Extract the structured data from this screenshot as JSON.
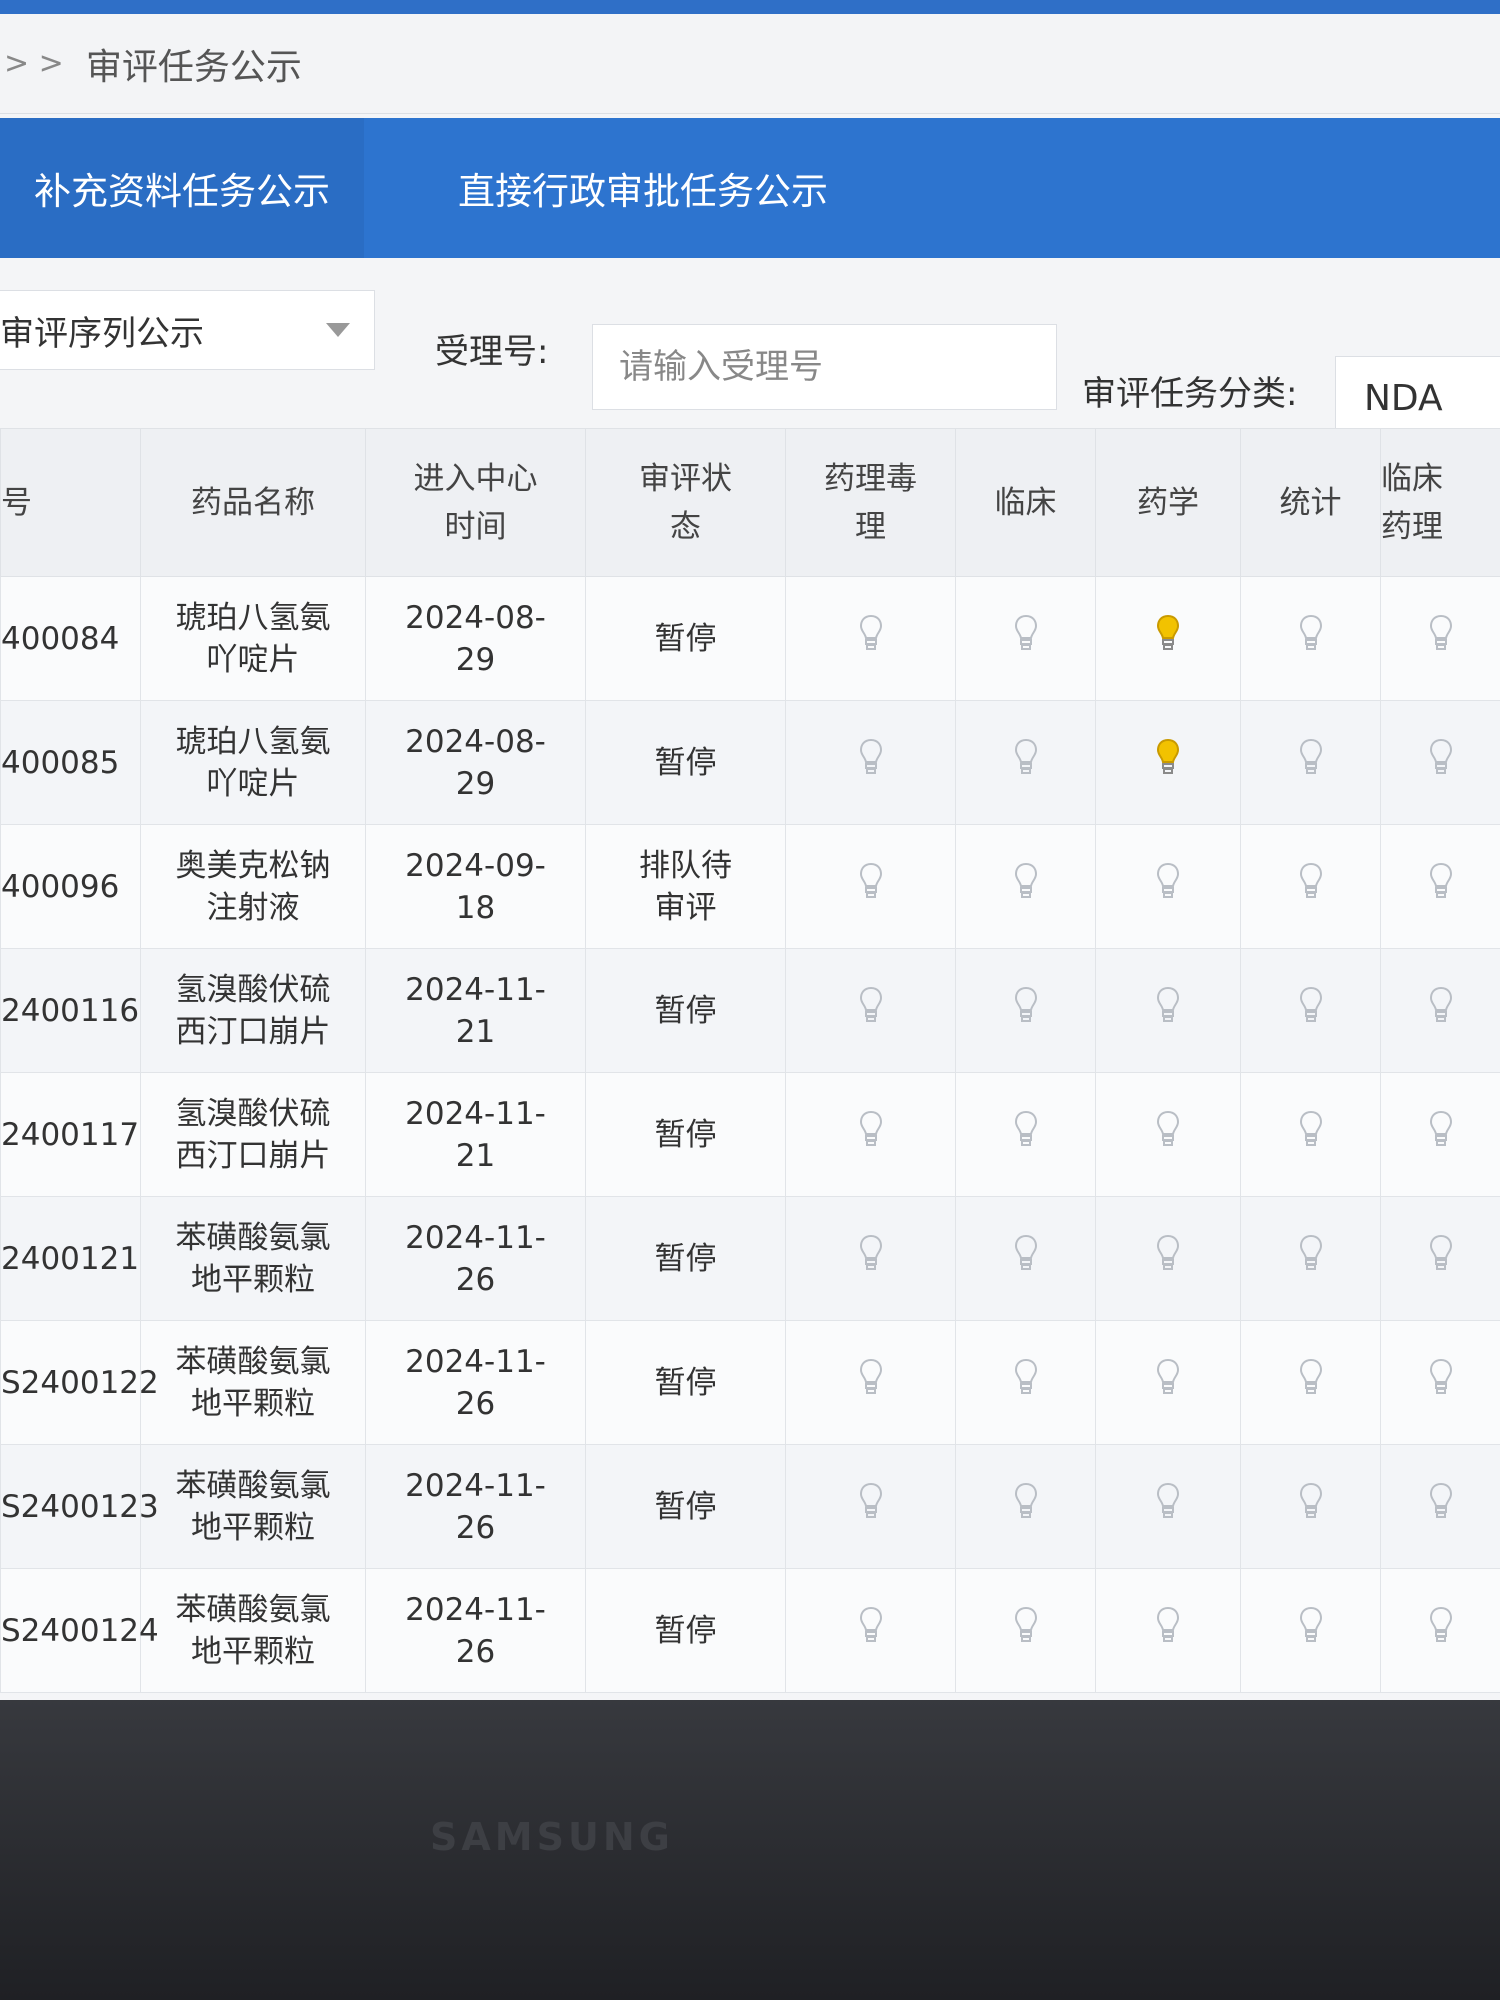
{
  "breadcrumb": {
    "separator": "> >",
    "current": "审评任务公示"
  },
  "tabs": [
    {
      "label": "补充资料任务公示"
    },
    {
      "label": "直接行政审批任务公示"
    }
  ],
  "filters": {
    "sequence_select": "审评序列公示",
    "accept_no_label": "受理号:",
    "accept_no_placeholder": "请输入受理号",
    "category_label": "审评任务分类:",
    "category_value": "NDA"
  },
  "table": {
    "headers": {
      "no": "号",
      "drug": "药品名称",
      "time_l1": "进入中心",
      "time_l2": "时间",
      "status_l1": "审评状",
      "status_l2": "态",
      "pharm_l1": "药理毒",
      "pharm_l2": "理",
      "clinical": "临床",
      "pharmacy": "药学",
      "stats": "统计",
      "cp_l1": "临床",
      "cp_l2": "药理"
    },
    "rows": [
      {
        "no": "400084",
        "drug1": "琥珀八氢氨",
        "drug2": "吖啶片",
        "time1": "2024-08-",
        "time2": "29",
        "status1": "暂停",
        "status2": "",
        "active_col": 2
      },
      {
        "no": "400085",
        "drug1": "琥珀八氢氨",
        "drug2": "吖啶片",
        "time1": "2024-08-",
        "time2": "29",
        "status1": "暂停",
        "status2": "",
        "active_col": 2
      },
      {
        "no": "400096",
        "drug1": "奥美克松钠",
        "drug2": "注射液",
        "time1": "2024-09-",
        "time2": "18",
        "status1": "排队待",
        "status2": "审评",
        "active_col": -1
      },
      {
        "no": "2400116",
        "drug1": "氢溴酸伏硫",
        "drug2": "西汀口崩片",
        "time1": "2024-11-",
        "time2": "21",
        "status1": "暂停",
        "status2": "",
        "active_col": -1
      },
      {
        "no": "2400117",
        "drug1": "氢溴酸伏硫",
        "drug2": "西汀口崩片",
        "time1": "2024-11-",
        "time2": "21",
        "status1": "暂停",
        "status2": "",
        "active_col": -1
      },
      {
        "no": "2400121",
        "drug1": "苯磺酸氨氯",
        "drug2": "地平颗粒",
        "time1": "2024-11-",
        "time2": "26",
        "status1": "暂停",
        "status2": "",
        "active_col": -1
      },
      {
        "no": "S2400122",
        "drug1": "苯磺酸氨氯",
        "drug2": "地平颗粒",
        "time1": "2024-11-",
        "time2": "26",
        "status1": "暂停",
        "status2": "",
        "active_col": -1
      },
      {
        "no": "S2400123",
        "drug1": "苯磺酸氨氯",
        "drug2": "地平颗粒",
        "time1": "2024-11-",
        "time2": "26",
        "status1": "暂停",
        "status2": "",
        "active_col": -1
      },
      {
        "no": "S2400124",
        "drug1": "苯磺酸氨氯",
        "drug2": "地平颗粒",
        "time1": "2024-11-",
        "time2": "26",
        "status1": "暂停",
        "status2": "",
        "active_col": -1
      }
    ]
  },
  "colors": {
    "bulb_off": "#b9bec5",
    "bulb_on": "#f2c200",
    "tab_bar": "#2d74cf"
  },
  "monitor": {
    "brand": "SAMSUNG"
  }
}
